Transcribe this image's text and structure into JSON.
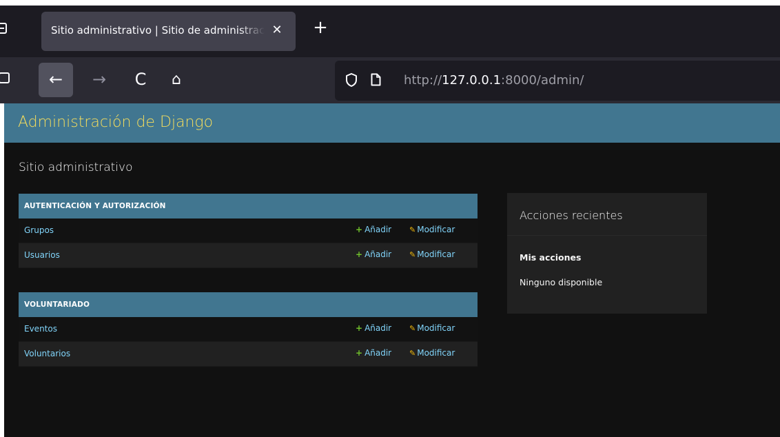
{
  "browser": {
    "tab": {
      "title": "Sitio administrativo | Sitio de administración de Django",
      "close_glyph": "✕"
    },
    "new_tab_glyph": "+",
    "nav": {
      "back_glyph": "←",
      "forward_glyph": "→",
      "reload_glyph": "C",
      "home_glyph": "⌂"
    },
    "url": {
      "scheme": "http://",
      "host": "127.0.0.1",
      "rest": ":8000/admin/"
    },
    "icons": [
      "tabs-icon",
      "sidebar-icon",
      "back-icon",
      "forward-icon",
      "reload-icon",
      "home-icon",
      "shield-icon",
      "page-icon",
      "close-icon",
      "plus-icon"
    ]
  },
  "admin": {
    "branding": "Administración de Django",
    "content_title": "Sitio administrativo",
    "add_label": "Añadir",
    "change_label": "Modificar",
    "apps": [
      {
        "caption": "Autenticación y autorización",
        "models": [
          "Grupos",
          "Usuarios"
        ]
      },
      {
        "caption": "Voluntariado",
        "models": [
          "Eventos",
          "Voluntarios"
        ]
      }
    ],
    "recent_actions": {
      "title": "Acciones recientes",
      "subtitle": "Mis acciones",
      "empty": "Ninguno disponible"
    },
    "colors": {
      "header_bg": "#417690",
      "branding": "#f5dd5d",
      "link": "#81d4fa",
      "add_icon": "#70bf2b",
      "change_icon": "#efb80b",
      "body_bg": "#121212"
    }
  }
}
